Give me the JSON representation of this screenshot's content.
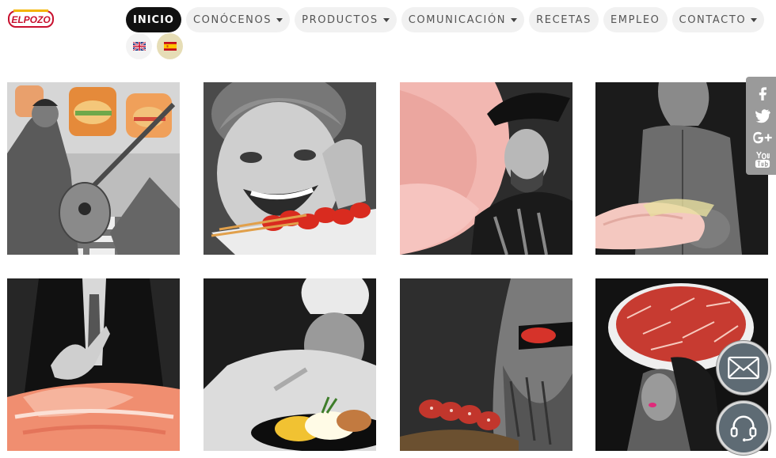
{
  "brand": {
    "logo_text": "ELPOZO",
    "color": "#c8102e"
  },
  "nav": {
    "items": [
      {
        "label": "INICIO",
        "active": true,
        "dropdown": false
      },
      {
        "label": "CONÓCENOS",
        "active": false,
        "dropdown": true
      },
      {
        "label": "PRODUCTOS",
        "active": false,
        "dropdown": true
      },
      {
        "label": "COMUNICACIÓN",
        "active": false,
        "dropdown": true
      },
      {
        "label": "RECETAS",
        "active": false,
        "dropdown": false
      },
      {
        "label": "EMPLEO",
        "active": false,
        "dropdown": false
      },
      {
        "label": "CONTACTO",
        "active": false,
        "dropdown": true
      }
    ]
  },
  "languages": [
    {
      "code": "en",
      "icon": "uk-flag-icon"
    },
    {
      "code": "es",
      "icon": "spain-flag-icon",
      "selected": true
    }
  ],
  "gallery": [
    {
      "name": "man-guitar-sandwich-image"
    },
    {
      "name": "laughing-child-chorizo-image"
    },
    {
      "name": "ham-slices-musketeer-image"
    },
    {
      "name": "fitness-woman-turkey-image"
    },
    {
      "name": "businessman-serrano-ham-image"
    },
    {
      "name": "chef-plating-dish-image"
    },
    {
      "name": "bearded-man-salami-image"
    },
    {
      "name": "woman-ham-platter-hat-image"
    }
  ],
  "social": {
    "items": [
      {
        "name": "facebook-icon",
        "glyph": "f"
      },
      {
        "name": "twitter-icon",
        "glyph": "t"
      },
      {
        "name": "google-plus-icon",
        "glyph": "G+"
      },
      {
        "name": "youtube-icon",
        "glyph": "YouTube"
      }
    ]
  },
  "floating": [
    {
      "name": "mail-icon"
    },
    {
      "name": "support-headset-icon"
    }
  ]
}
